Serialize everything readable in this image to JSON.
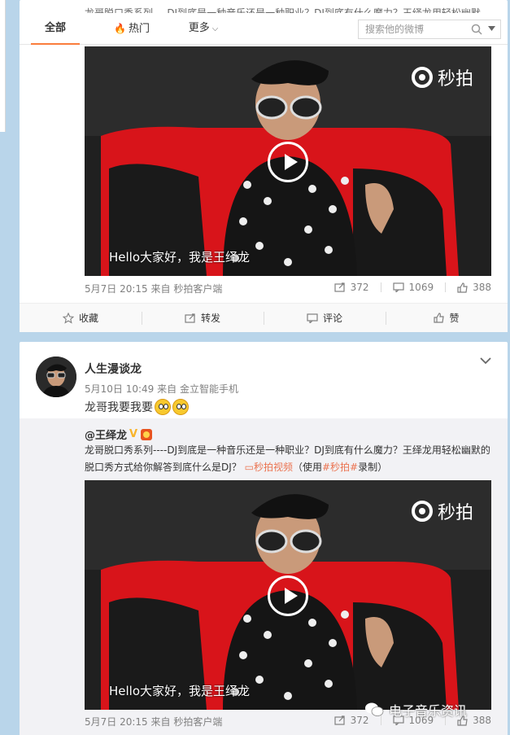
{
  "tabs": {
    "all": "全部",
    "hot": "热门",
    "more": "更多"
  },
  "search": {
    "placeholder": "搜索他的微博"
  },
  "top_strip_text": "龙哥脱口秀系列----DJ到底是一种音乐还是一种职业？DJ到底有什么魔力？王绎龙用轻松幽默",
  "post1": {
    "video_watermark": "秒拍",
    "subtitle": "Hello大家好，我是王绎龙",
    "time": "5月7日 20:15",
    "source": "来自 秒拍客户端",
    "reposts": "372",
    "comments": "1069",
    "likes": "388",
    "actions": {
      "favorite": "收藏",
      "repost": "转发",
      "comment": "评论",
      "like": "赞"
    }
  },
  "post2": {
    "username": "人生漫谈龙",
    "time": "5月10日 10:49",
    "source": "来自 金立智能手机",
    "text": "龙哥我要我要",
    "repost": {
      "author": "@王绎龙",
      "text_part1": "龙哥脱口秀系列----DJ到底是一种音乐还是一种职业？DJ到底有什么魔力？王绎龙用轻松幽默的脱口秀方式给你解答到底什么是DJ？",
      "link_label": "秒拍视频",
      "text_part2": "（使用",
      "hashtag": "#秒拍#",
      "text_part3": "录制）",
      "video_watermark": "秒拍",
      "subtitle": "Hello大家好，我是王绎龙",
      "time": "5月7日 20:15",
      "source": "来自 秒拍客户端",
      "reposts": "372",
      "comments": "1069",
      "likes": "388"
    }
  },
  "wechat_watermark": "电子音乐资讯",
  "colors": {
    "accent_orange": "#fa7d3c",
    "link_orange": "#eb7350",
    "background": "#b9d5ea"
  }
}
